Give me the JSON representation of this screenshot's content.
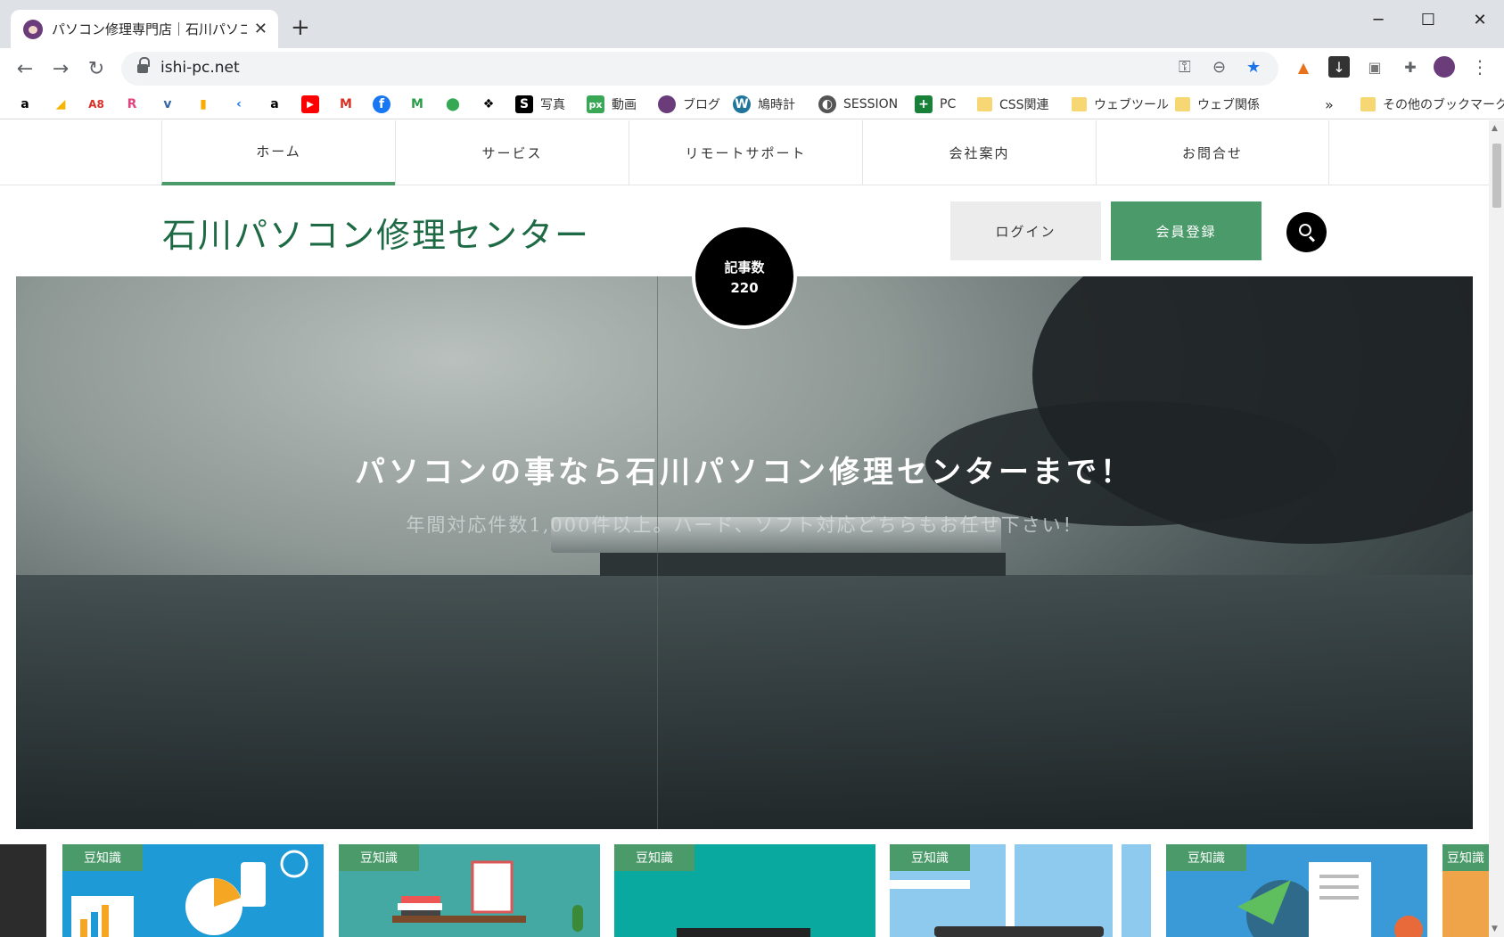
{
  "browser": {
    "tab_title": "パソコン修理専門店｜石川パソコン修理センター",
    "new_tab_symbol": "+",
    "url": "ishi-pc.net",
    "window_controls": {
      "minimize": "─",
      "maximize": "☐",
      "close": "✕"
    }
  },
  "bookmarks": {
    "items": [
      {
        "label": "写真",
        "icon": "S"
      },
      {
        "label": "動画",
        "icon": "px"
      },
      {
        "label": "ブログ",
        "icon": "avatar"
      },
      {
        "label": "鳩時計",
        "icon": "W"
      },
      {
        "label": "SESSION",
        "icon": "globe"
      },
      {
        "label": "PC",
        "icon": "+"
      },
      {
        "label": "CSS関連",
        "icon": "folder"
      },
      {
        "label": "ウェブツール",
        "icon": "folder"
      },
      {
        "label": "ウェブ関係",
        "icon": "folder"
      }
    ],
    "overflow": "»",
    "other": "その他のブックマーク",
    "icon_only": [
      "a",
      "A8",
      "R",
      "w",
      "fx",
      "a",
      "youtube",
      "M",
      "f",
      "Mf",
      "maps",
      "tools"
    ]
  },
  "nav": {
    "items": [
      "ホーム",
      "サービス",
      "リモートサポート",
      "会社案内",
      "お問合せ"
    ],
    "active_index": 0
  },
  "header": {
    "site_title": "石川パソコン修理センター",
    "login": "ログイン",
    "signup": "会員登録"
  },
  "badge": {
    "label": "記事数",
    "value": "220"
  },
  "hero": {
    "title": "パソコンの事なら石川パソコン修理センターまで！",
    "subtitle": "年間対応件数1,000件以上。ハード、ソフト対応どちらもお任せ下さい！"
  },
  "cards": {
    "tag": "豆知識",
    "colors": [
      "#1e9ad6",
      "#44a9a2",
      "#0aa9a0",
      "#4aa7df",
      "#3a9ad8"
    ]
  },
  "colors": {
    "accent": "#4a9a6a",
    "title": "#1e6a45"
  }
}
